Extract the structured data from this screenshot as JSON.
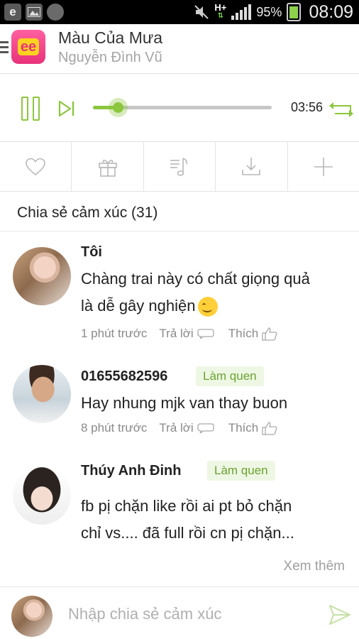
{
  "status_bar": {
    "network": "H+",
    "battery": "95%",
    "time": "08:09"
  },
  "header": {
    "logo_text": "ee",
    "title": "Màu Của Mưa",
    "artist": "Nguyễn Đình Vũ"
  },
  "player": {
    "current_time": "03:56",
    "progress": 0.14,
    "state": "playing"
  },
  "actions": [
    {
      "name": "like",
      "icon": "heart-icon"
    },
    {
      "name": "gift",
      "icon": "gift-icon"
    },
    {
      "name": "lyrics",
      "icon": "lyrics-icon"
    },
    {
      "name": "download",
      "icon": "download-icon"
    },
    {
      "name": "add",
      "icon": "plus-icon"
    }
  ],
  "comments_section": {
    "title": "Chia sẻ cảm xúc (31)",
    "see_more": "Xem thêm"
  },
  "comments": [
    {
      "name": "Tôi",
      "text_line1": "Chàng trai này có chất giọng quả",
      "text_line2": "là dễ gây nghiện",
      "time": "1 phút trước",
      "reply": "Trả lời",
      "like": "Thích"
    },
    {
      "name": "01655682596",
      "badge": "Làm quen",
      "text_line1": "Hay nhung mjk van thay buon",
      "time": "8 phút trước",
      "reply": "Trả lời",
      "like": "Thích"
    },
    {
      "name": "Thúy Anh Đinh",
      "badge": "Làm quen",
      "text_line1": "fb pị chặn like rồi ai pt bỏ chặn",
      "text_line2": "chỉ vs.... đã full rồi cn pị chặn..."
    }
  ],
  "input": {
    "placeholder": "Nhập chia sẻ cảm xúc"
  },
  "colors": {
    "accent": "#8cc63e",
    "badge_bg": "#eef7e4",
    "muted_text": "#a5a5a5"
  }
}
